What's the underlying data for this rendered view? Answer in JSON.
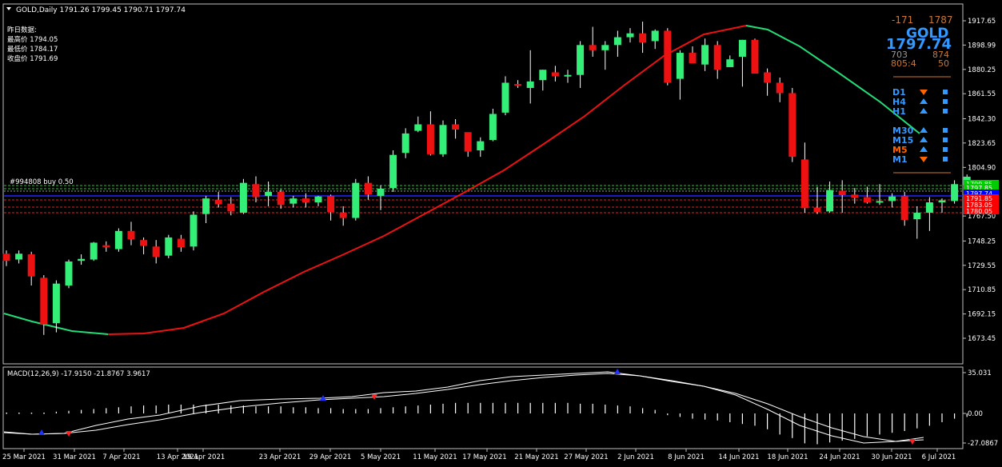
{
  "symbol_header": "GOLD,Daily  1791.26 1799.45 1790.71 1797.74",
  "info_lines": [
    "昨日数据:",
    "最高价 1794.05",
    "最低价 1784.17",
    "收盘价 1791.69"
  ],
  "order_label": "#994808 buy 0.50",
  "price_axis_labels": [
    "1917.65",
    "1898.99",
    "1880.25",
    "1861.55",
    "1842.30",
    "1823.65",
    "1804.90",
    "1767.50",
    "1748.25",
    "1729.55",
    "1710.85",
    "1692.15",
    "1673.45"
  ],
  "price_tags": [
    {
      "text": "1799.85",
      "color": "#00cc00"
    },
    {
      "text": "1797.85",
      "color": "#00cc00"
    },
    {
      "text": "1797.74",
      "color": "#0000ff"
    },
    {
      "text": "1791.85",
      "color": "#ff0000"
    },
    {
      "text": "1783.05",
      "color": "#ff0000"
    },
    {
      "text": "1780.05",
      "color": "#ff0000"
    }
  ],
  "date_labels": [
    "25 Mar 2021",
    "31 Mar 2021",
    "7 Apr 2021",
    "13 Apr 2021",
    "19 Apr 2021",
    "23 Apr 2021",
    "29 Apr 2021",
    "5 May 2021",
    "11 May 2021",
    "17 May 2021",
    "21 May 2021",
    "27 May 2021",
    "2 Jun 2021",
    "8 Jun 2021",
    "14 Jun 2021",
    "18 Jun 2021",
    "24 Jun 2021",
    "30 Jun 2021",
    "6 Jul 2021"
  ],
  "macd_header": "MACD(12,26,9) -17.9150 -21.8767 3.9617",
  "macd_axis_labels": [
    "35.031",
    "0.00",
    "-27.0867"
  ],
  "panel": {
    "top_left": "-171",
    "top_right": "1787",
    "symbol": "GOLD",
    "price": "1797.74",
    "mid_left": "703",
    "mid_right": "874",
    "bot_left": "805:4",
    "bot_right": "50",
    "timeframes": [
      {
        "label": "D1",
        "dir": "down"
      },
      {
        "label": "H4",
        "dir": "up"
      },
      {
        "label": "H1",
        "dir": "up"
      },
      {
        "label": "M30",
        "dir": "up"
      },
      {
        "label": "M15",
        "dir": "up"
      },
      {
        "label": "M5",
        "dir": "up"
      },
      {
        "label": "M1",
        "dir": "down"
      }
    ]
  },
  "colors": {
    "bull": "#33ee77",
    "bear": "#ee1111",
    "ma_up": "#ee1111",
    "ma_down": "#22dd77",
    "axis": "#ffffff",
    "panel_blue": "#3399ff",
    "panel_orange": "#ff6600"
  },
  "chart_data": {
    "type": "candlestick",
    "series": [
      {
        "name": "GOLD Daily",
        "ohlc": [
          [
            1738.5,
            1741.0,
            1729.0,
            1733.0
          ],
          [
            1734.0,
            1741.0,
            1731.0,
            1738.5
          ],
          [
            1738.0,
            1740.0,
            1714.0,
            1721.0
          ],
          [
            1720.0,
            1722.0,
            1676.0,
            1684.0
          ],
          [
            1685.0,
            1718.0,
            1678.0,
            1715.5
          ],
          [
            1714.0,
            1734.0,
            1712.0,
            1732.5
          ],
          [
            1733.0,
            1738.0,
            1730.0,
            1734.5
          ],
          [
            1734.0,
            1747.5,
            1733.0,
            1747.0
          ],
          [
            1745.0,
            1748.0,
            1740.0,
            1743.5
          ],
          [
            1742.0,
            1758.0,
            1740.0,
            1756.0
          ],
          [
            1756.0,
            1763.0,
            1745.0,
            1749.5
          ],
          [
            1749.0,
            1751.0,
            1738.0,
            1744.5
          ],
          [
            1744.0,
            1749.0,
            1731.0,
            1736.0
          ],
          [
            1737.0,
            1753.0,
            1735.0,
            1751.0
          ],
          [
            1750.0,
            1753.0,
            1740.0,
            1743.5
          ],
          [
            1744.0,
            1771.0,
            1741.0,
            1768.5
          ],
          [
            1769.0,
            1783.0,
            1762.0,
            1781.0
          ],
          [
            1780.0,
            1786.0,
            1774.0,
            1776.5
          ],
          [
            1777.0,
            1782.0,
            1768.0,
            1771.0
          ],
          [
            1770.0,
            1796.0,
            1769.0,
            1793.0
          ],
          [
            1792.0,
            1798.0,
            1778.0,
            1782.0
          ],
          [
            1783.0,
            1794.0,
            1775.0,
            1786.0
          ],
          [
            1786.0,
            1788.0,
            1773.0,
            1776.0
          ],
          [
            1777.0,
            1783.0,
            1774.0,
            1781.0
          ],
          [
            1781.0,
            1785.0,
            1774.0,
            1778.0
          ],
          [
            1778.0,
            1783.0,
            1775.0,
            1782.5
          ],
          [
            1783.0,
            1784.0,
            1764.0,
            1770.5
          ],
          [
            1770.0,
            1775.0,
            1760.0,
            1766.0
          ],
          [
            1766.0,
            1796.0,
            1764.0,
            1793.0
          ],
          [
            1793.0,
            1798.0,
            1780.0,
            1784.0
          ],
          [
            1783.0,
            1791.0,
            1772.0,
            1788.5
          ],
          [
            1789.0,
            1818.0,
            1786.0,
            1814.5
          ],
          [
            1816.0,
            1835.0,
            1812.0,
            1831.0
          ],
          [
            1833.0,
            1844.0,
            1832.0,
            1838.0
          ],
          [
            1838.0,
            1848.0,
            1814.0,
            1815.0
          ],
          [
            1815.0,
            1841.0,
            1813.0,
            1837.5
          ],
          [
            1838.0,
            1842.0,
            1827.0,
            1834.0
          ],
          [
            1832.0,
            1828.0,
            1813.0,
            1817.0
          ],
          [
            1818.0,
            1828.0,
            1813.0,
            1825.0
          ],
          [
            1826.0,
            1850.0,
            1825.0,
            1846.0
          ],
          [
            1847.0,
            1875.0,
            1845.0,
            1870.0
          ],
          [
            1869.0,
            1872.0,
            1866.0,
            1868.0
          ],
          [
            1866.0,
            1895.0,
            1854.0,
            1871.0
          ],
          [
            1872.0,
            1880.0,
            1864.0,
            1880.0
          ],
          [
            1878.0,
            1883.0,
            1871.0,
            1875.0
          ],
          [
            1876.0,
            1880.0,
            1870.0,
            1876.0
          ],
          [
            1876.0,
            1902.0,
            1866.0,
            1899.0
          ],
          [
            1899.0,
            1913.0,
            1890.0,
            1895.0
          ],
          [
            1895.0,
            1902.0,
            1880.0,
            1899.0
          ],
          [
            1899.0,
            1910.0,
            1890.0,
            1905.0
          ],
          [
            1905.0,
            1912.0,
            1901.0,
            1908.0
          ],
          [
            1908.0,
            1917.0,
            1893.0,
            1901.0
          ],
          [
            1902.0,
            1911.0,
            1896.0,
            1910.0
          ],
          [
            1910.0,
            1912.0,
            1868.0,
            1870.0
          ],
          [
            1873.0,
            1895.0,
            1857.0,
            1893.0
          ],
          [
            1893.0,
            1898.0,
            1886.0,
            1885.0
          ],
          [
            1884.0,
            1904.0,
            1879.0,
            1899.0
          ],
          [
            1899.0,
            1902.0,
            1873.0,
            1880.0
          ],
          [
            1882.0,
            1891.0,
            1884.0,
            1888.0
          ],
          [
            1890.0,
            1903.0,
            1867.0,
            1903.0
          ],
          [
            1903.0,
            1904.0,
            1887.0,
            1877.0
          ],
          [
            1878.0,
            1881.0,
            1860.0,
            1870.0
          ],
          [
            1870.0,
            1874.0,
            1855.0,
            1862.0
          ],
          [
            1862.0,
            1866.0,
            1809.0,
            1813.0
          ],
          [
            1811.0,
            1824.0,
            1770.0,
            1773.5
          ],
          [
            1774.0,
            1790.0,
            1769.0,
            1770.5
          ],
          [
            1771.0,
            1794.0,
            1770.0,
            1787.5
          ],
          [
            1787.0,
            1795.0,
            1770.0,
            1783.5
          ],
          [
            1784.0,
            1789.0,
            1777.0,
            1781.5
          ],
          [
            1782.0,
            1790.0,
            1777.0,
            1778.0
          ],
          [
            1778.0,
            1792.0,
            1776.0,
            1779.0
          ],
          [
            1779.0,
            1785.0,
            1774.0,
            1782.5
          ],
          [
            1783.0,
            1786.0,
            1760.0,
            1764.5
          ],
          [
            1765.0,
            1775.0,
            1750.0,
            1770.0
          ],
          [
            1770.0,
            1782.0,
            1756.0,
            1778.0
          ],
          [
            1778.0,
            1781.0,
            1770.0,
            1779.5
          ],
          [
            1779.0,
            1795.0,
            1777.0,
            1792.0
          ],
          [
            1791.26,
            1799.45,
            1790.71,
            1797.74
          ]
        ]
      }
    ],
    "x_tick_labels": [
      "25 Mar 2021",
      "31 Mar 2021",
      "7 Apr 2021",
      "13 Apr 2021",
      "19 Apr 2021",
      "23 Apr 2021",
      "29 Apr 2021",
      "5 May 2021",
      "11 May 2021",
      "17 May 2021",
      "21 May 2021",
      "27 May 2021",
      "2 Jun 2021",
      "8 Jun 2021",
      "14 Jun 2021",
      "18 Jun 2021",
      "24 Jun 2021",
      "30 Jun 2021",
      "6 Jul 2021"
    ],
    "ylim": [
      1673.45,
      1917.65
    ],
    "macd": {
      "label": "MACD(12,26,9)",
      "main": -17.915,
      "signal": -21.8767,
      "histogram": 3.9617,
      "ylim": [
        -27.0867,
        35.031
      ]
    }
  }
}
